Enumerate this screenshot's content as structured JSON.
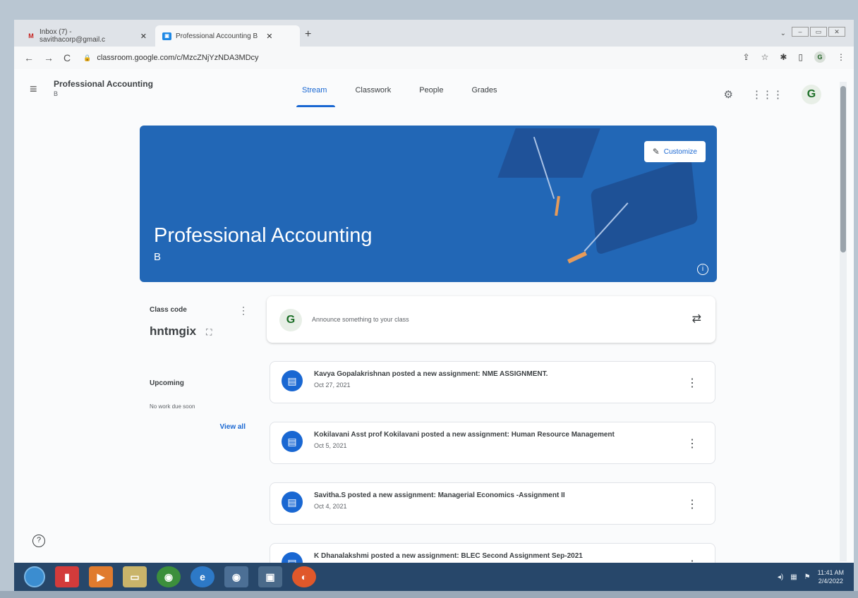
{
  "browser": {
    "tabs": [
      {
        "label": "Inbox (7) - savithacorp@gmail.c",
        "icon": "gmail-icon",
        "close": "✕"
      },
      {
        "label": "Professional Accounting B",
        "icon": "classroom-icon",
        "close": "✕"
      }
    ],
    "new_tab": "+",
    "url": "classroom.google.com/c/MzcZNjYzNDA3MDcy"
  },
  "app": {
    "class_title": "Professional Accounting",
    "class_section": "B",
    "nav_tabs": [
      "Stream",
      "Classwork",
      "People",
      "Grades"
    ],
    "active_tab": "Stream"
  },
  "banner": {
    "title": "Professional Accounting",
    "section": "B",
    "customize_label": "Customize",
    "color": "#2267b6"
  },
  "class_code": {
    "label": "Class code",
    "value": "hntmgix"
  },
  "upcoming": {
    "title": "Upcoming",
    "empty_text": "No work due soon",
    "view_all": "View all"
  },
  "announce": {
    "placeholder": "Announce something to your class"
  },
  "posts": [
    {
      "text": "Kavya Gopalakrishnan posted a new assignment: NME ASSIGNMENT.",
      "date": "Oct 27, 2021"
    },
    {
      "text": "Kokilavani Asst prof Kokilavani posted a new assignment: Human Resource Management",
      "date": "Oct 5, 2021"
    },
    {
      "text": "Savitha.S posted a new assignment: Managerial Economics -Assignment II",
      "date": "Oct 4, 2021"
    },
    {
      "text": "K Dhanalakshmi posted a new assignment: BLEC Second Assignment Sep-2021",
      "date": ""
    }
  ],
  "taskbar": {
    "clock_time": "11:41 AM",
    "clock_date": "2/4/2022"
  },
  "colors": {
    "accent": "#1967d2",
    "taskbar": "#27476a"
  }
}
